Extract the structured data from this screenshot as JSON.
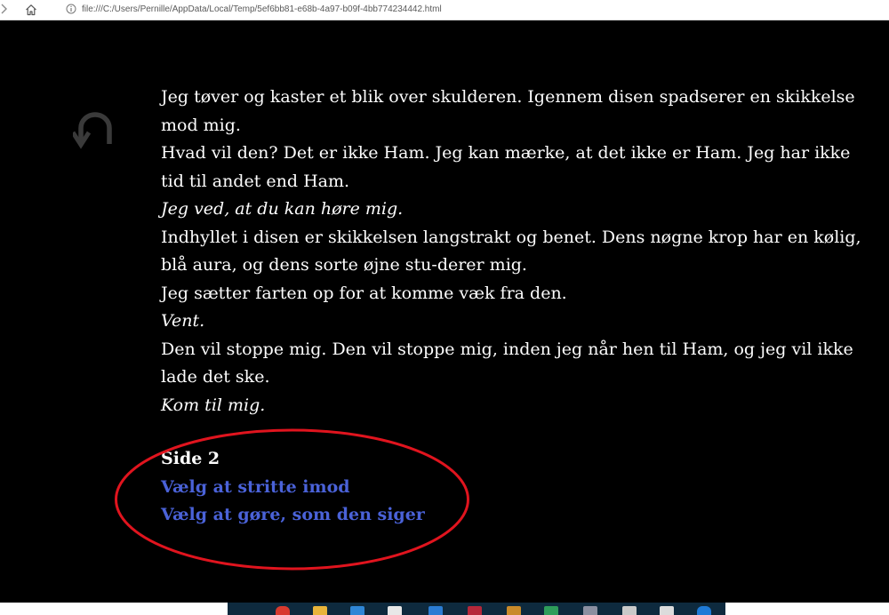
{
  "browser": {
    "url": "file:///C:/Users/Pernille/AppData/Local/Temp/5ef6bb81-e68b-4a97-b09f-4bb774234442.html"
  },
  "story": {
    "paragraphs": [
      {
        "text": "Jeg tøver og kaster et blik over skulderen. Igennem disen spadserer en skikkelse mod mig.",
        "italic": false
      },
      {
        "text": "Hvad vil den? Det er ikke Ham. Jeg kan mærke, at det ikke er Ham. Jeg har ikke tid til andet end Ham.",
        "italic": false
      },
      {
        "text": "Jeg ved, at du kan høre mig.",
        "italic": true
      },
      {
        "text": "Indhyllet i disen er skikkelsen langstrakt og benet. Dens nøgne krop har en kølig, blå aura, og dens sorte øjne stu-derer mig.",
        "italic": false
      },
      {
        "text": "Jeg sætter farten op for at komme væk fra den.",
        "italic": false
      },
      {
        "text": "Vent.",
        "italic": true
      },
      {
        "text": "Den vil stoppe mig. Den vil stoppe mig, inden jeg når hen til Ham, og jeg vil ikke lade det ske.",
        "italic": false
      },
      {
        "text": "Kom til mig.",
        "italic": true
      }
    ]
  },
  "choices": {
    "page_label": "Side 2",
    "options": [
      "Vælg at stritte imod",
      "Vælg at gøre, som den siger"
    ]
  },
  "icons": {
    "back": "undo-arrow-icon",
    "home": "home-icon",
    "info": "info-icon",
    "annotation": "red-ellipse-annotation"
  },
  "colors": {
    "background": "#000000",
    "text": "#fdfdfd",
    "link": "#4a62d8",
    "annotation": "#e0141e",
    "back_icon": "#3a3a3a"
  }
}
